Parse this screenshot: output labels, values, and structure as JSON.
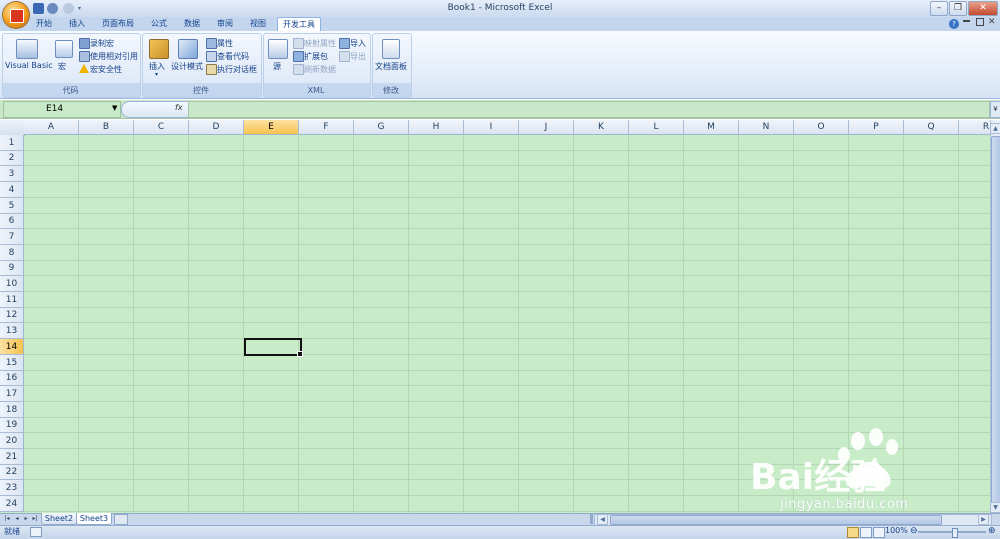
{
  "window": {
    "title": "Book1 - Microsoft Excel",
    "minimize": "–",
    "restore": "❐",
    "close": "✕",
    "help": "?"
  },
  "tabs": [
    {
      "label": "开始"
    },
    {
      "label": "插入"
    },
    {
      "label": "页面布局"
    },
    {
      "label": "公式"
    },
    {
      "label": "数据"
    },
    {
      "label": "审阅"
    },
    {
      "label": "视图"
    },
    {
      "label": "开发工具"
    }
  ],
  "active_tab": "开发工具",
  "ribbon": {
    "code": {
      "label": "代码",
      "visual_basic": "Visual Basic",
      "macro": "宏",
      "record_macro": "录制宏",
      "relative_ref": "使用相对引用",
      "macro_security": "宏安全性"
    },
    "controls": {
      "label": "控件",
      "insert": "插入",
      "design_mode": "设计模式",
      "properties": "属性",
      "view_code": "查看代码",
      "run_dialog": "执行对话框"
    },
    "xml": {
      "label": "XML",
      "source": "源",
      "map_properties": "映射属性",
      "expansion_packs": "扩展包",
      "refresh_data": "刷新数据",
      "import": "导入",
      "export": "导出"
    },
    "modify": {
      "label": "修改",
      "document_panel": "文档面板"
    }
  },
  "formula_bar": {
    "name_box": "E14",
    "fx": "fx",
    "value": ""
  },
  "columns": [
    "A",
    "B",
    "C",
    "D",
    "E",
    "F",
    "G",
    "H",
    "I",
    "J",
    "K",
    "L",
    "M",
    "N",
    "O",
    "P",
    "Q",
    "R"
  ],
  "rows": [
    "1",
    "2",
    "3",
    "4",
    "5",
    "6",
    "7",
    "8",
    "9",
    "10",
    "11",
    "12",
    "13",
    "14",
    "15",
    "16",
    "17",
    "18",
    "19",
    "20",
    "21",
    "22",
    "23",
    "24"
  ],
  "active_cell": {
    "column": "E",
    "row": "14"
  },
  "sheets": [
    {
      "label": "Sheet2"
    },
    {
      "label": "Sheet3"
    }
  ],
  "status_bar": {
    "text": "就绪",
    "zoom": "100%"
  },
  "watermark": {
    "text": "Bai经验",
    "url": "jingyan.baidu.com"
  },
  "colors": {
    "grid_background": "#c8ecc8",
    "selected_header": "#f7c24f",
    "ribbon": "#dfe9f5"
  }
}
